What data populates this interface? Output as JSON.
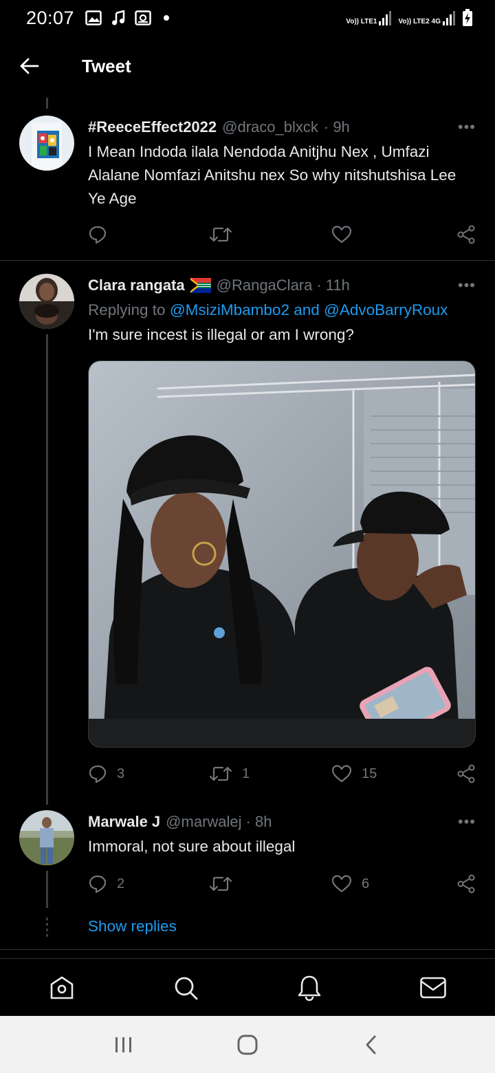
{
  "status_bar": {
    "time": "20:07",
    "sim1": "Vo)) LTE1",
    "sim2": "Vo)) LTE2",
    "network": "4G",
    "battery_icon": "battery-charging-icon"
  },
  "header": {
    "title": "Tweet",
    "back_icon": "arrow-left-icon"
  },
  "tweets": [
    {
      "name": "#ReeceEffect2022",
      "handle": "@draco_blxck",
      "time": "· 9h",
      "text": "I Mean Indoda ilala Nendoda Anitjhu Nex , Umfazi Alalane Nomfazi Anitshu nex So why nitshutshisa Lee Ye Age",
      "replies": "",
      "retweets": "",
      "likes": ""
    },
    {
      "name": "Clara rangata",
      "flag": "🇿🇦",
      "handle": "@RangaClara",
      "time": "· 11h",
      "replying_prefix": "Replying to ",
      "replying_to_1": "@MsiziMbambo2",
      "replying_and": " and ",
      "replying_to_2": "@AdvoBarryRoux",
      "text": "I'm sure incest is illegal or am I wrong?",
      "replies": "3",
      "retweets": "1",
      "likes": "15"
    },
    {
      "name": "Marwale J",
      "handle": "@marwalej",
      "time": "· 8h",
      "text": "Immoral, not sure about illegal",
      "replies": "2",
      "retweets": "",
      "likes": "6"
    }
  ],
  "more_label": "•••",
  "show_replies": "Show replies",
  "bottom_nav": [
    "home-icon",
    "search-icon",
    "bell-icon",
    "mail-icon"
  ],
  "system_nav": [
    "recent-apps-icon",
    "home-circle-icon",
    "back-chevron-icon"
  ],
  "colors": {
    "background": "#000000",
    "text": "#e7e9ea",
    "muted": "#71767b",
    "link": "#1d9bf0",
    "divider": "#2f3336"
  }
}
